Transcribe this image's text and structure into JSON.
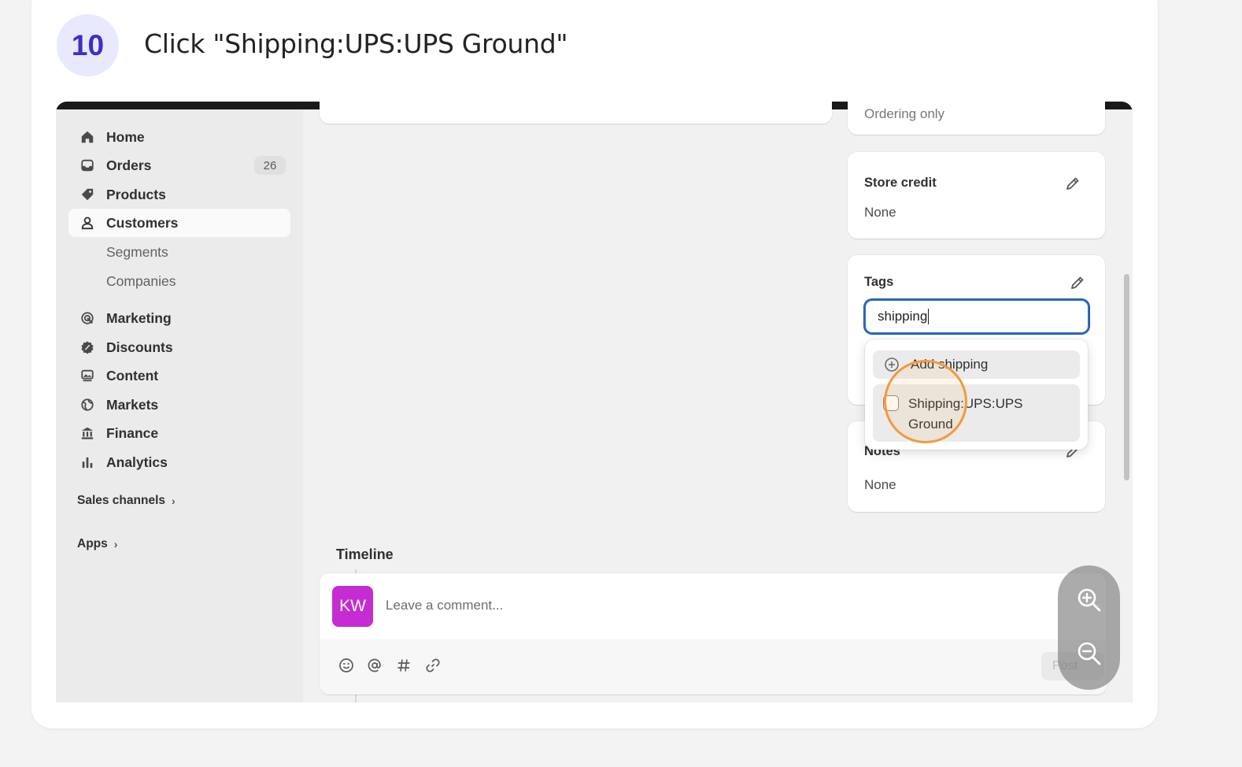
{
  "step": {
    "number": "10",
    "title": "Click \"Shipping:UPS:UPS Ground\""
  },
  "sidebar": {
    "items": [
      {
        "label": "Home",
        "icon": "home-icon"
      },
      {
        "label": "Orders",
        "icon": "inbox-icon",
        "badge": "26"
      },
      {
        "label": "Products",
        "icon": "tag-icon"
      },
      {
        "label": "Customers",
        "icon": "person-icon",
        "active": true
      },
      {
        "label": "Segments"
      },
      {
        "label": "Companies"
      },
      {
        "label": "Marketing",
        "icon": "target-icon"
      },
      {
        "label": "Discounts",
        "icon": "discount-icon"
      },
      {
        "label": "Content",
        "icon": "image-icon"
      },
      {
        "label": "Markets",
        "icon": "globe-icon"
      },
      {
        "label": "Finance",
        "icon": "bank-icon"
      },
      {
        "label": "Analytics",
        "icon": "bar-chart-icon"
      }
    ],
    "sales_channels": "Sales channels",
    "apps": "Apps"
  },
  "right_column": {
    "top_partial_text": "Ordering only",
    "store_credit": {
      "title": "Store credit",
      "value": "None"
    },
    "tags": {
      "title": "Tags",
      "input_value": "shipping",
      "dropdown": {
        "add_label": "Add shipping",
        "option_label": "Shipping:UPS:UPS Ground"
      }
    },
    "notes": {
      "title": "Notes",
      "value": "None"
    }
  },
  "timeline": {
    "title": "Timeline",
    "avatar_initials": "KW",
    "comment_placeholder": "Leave a comment...",
    "post_label": "Post"
  },
  "colors": {
    "accent_badge_bg": "#e8e9fd",
    "accent_badge_text": "#3b2fc9",
    "avatar": "#c52cd1",
    "focus_ring": "#2c6ecb",
    "click_ring": "#f39a3b"
  }
}
